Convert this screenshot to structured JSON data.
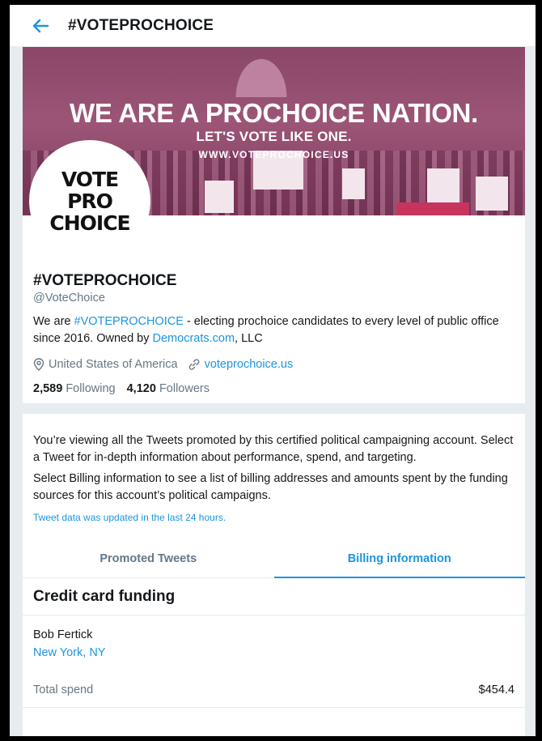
{
  "header": {
    "title": "#VOTEPROCHOICE"
  },
  "banner": {
    "line1": "WE ARE A PROCHOICE NATION.",
    "line2": "LET'S VOTE LIKE ONE.",
    "line3": "WWW.VOTEPROCHOICE.US"
  },
  "avatar": {
    "lines": [
      "VOTE",
      "PRO",
      "CHOICE"
    ]
  },
  "profile": {
    "name": "#VOTEPROCHOICE",
    "handle": "@VoteChoice",
    "bio": {
      "before": "We are ",
      "hashtag": "#VOTEPROCHOICE",
      "middle": " - electing prochoice candidates to every level of public office since 2016. Owned by ",
      "owner_link": "Democrats.com",
      "after": ", LLC"
    },
    "location": "United States of America",
    "website": "voteprochoice.us",
    "following_count": "2,589",
    "following_label": "Following",
    "followers_count": "4,120",
    "followers_label": "Followers"
  },
  "info": {
    "paragraph1": "You’re viewing all the Tweets promoted by this certified political campaigning account. Select a Tweet for in-depth information about performance, spend, and targeting.",
    "paragraph2": "Select Billing information to see a list of billing addresses and amounts spent by the funding sources for this account’s political campaigns.",
    "note": "Tweet data was updated in the last 24 hours."
  },
  "tabs": [
    {
      "label": "Promoted Tweets",
      "active": false
    },
    {
      "label": "Billing information",
      "active": true
    }
  ],
  "billing": {
    "section_title": "Credit card funding",
    "funder_name": "Bob Fertick",
    "funder_location": "New York, NY",
    "total_label": "Total spend",
    "total_value": "$454.4"
  },
  "colors": {
    "accent": "#1b95e0",
    "muted": "#657786",
    "banner": "#9c5577"
  },
  "icons": {
    "back": "back-arrow-icon",
    "location": "location-pin-icon",
    "link": "link-icon"
  }
}
